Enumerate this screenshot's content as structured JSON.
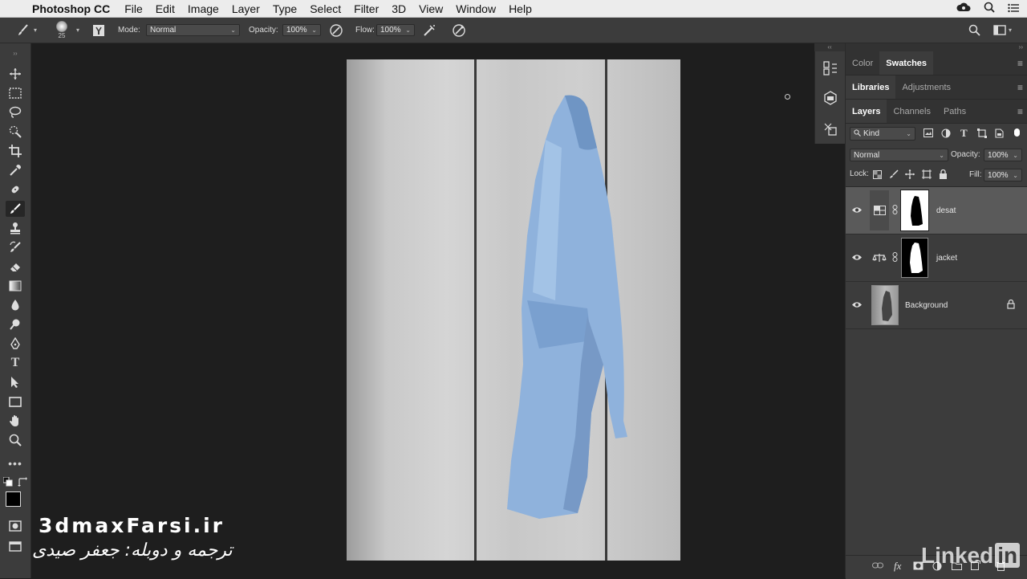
{
  "menubar": {
    "app_name": "Photoshop CC",
    "items": [
      "File",
      "Edit",
      "Image",
      "Layer",
      "Type",
      "Select",
      "Filter",
      "3D",
      "View",
      "Window",
      "Help"
    ]
  },
  "options": {
    "brush_size": "25",
    "mode_label": "Mode:",
    "mode_value": "Normal",
    "opacity_label": "Opacity:",
    "opacity_value": "100%",
    "flow_label": "Flow:",
    "flow_value": "100%"
  },
  "panels": {
    "tabs_row1": [
      "Color",
      "Swatches"
    ],
    "tabs_row2": [
      "Libraries",
      "Adjustments"
    ],
    "tabs_row3": [
      "Layers",
      "Channels",
      "Paths"
    ],
    "kind_label": "Kind",
    "blend_mode": "Normal",
    "opacity_label": "Opacity:",
    "opacity_value": "100%",
    "lock_label": "Lock:",
    "fill_label": "Fill:",
    "fill_value": "100%"
  },
  "layers": [
    {
      "name": "desat",
      "selected": true
    },
    {
      "name": "jacket",
      "selected": false
    },
    {
      "name": "Background",
      "selected": false,
      "locked": true
    }
  ],
  "watermark": {
    "line1": "3dmaxFarsi.ir",
    "line2": "ترجمه و دوبله: جعفر صیدی",
    "brand": "Linked",
    "brand_suffix": "in"
  }
}
